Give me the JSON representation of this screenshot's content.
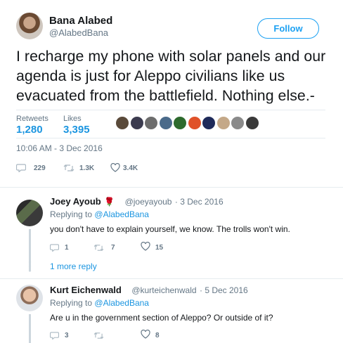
{
  "author": {
    "name": "Bana Alabed",
    "handle": "@AlabedBana",
    "follow_label": "Follow"
  },
  "tweet": {
    "text": "I recharge my phone with solar panels and our agenda is just for Aleppo civilians like us evacuated from the battlefield. Nothing else.-",
    "retweets_label": "Retweets",
    "retweets": "1,280",
    "likes_label": "Likes",
    "likes": "3,395",
    "timestamp": "10:06 AM - 3 Dec 2016",
    "reply_count": "229",
    "retweet_count": "1.3K",
    "like_count": "3.4K"
  },
  "likers": [
    {
      "color": "#5a4a3a"
    },
    {
      "color": "#3b3b4f"
    },
    {
      "color": "#6d6d6d"
    },
    {
      "color": "#4a6a8a"
    },
    {
      "color": "#2d6a2d"
    },
    {
      "color": "#e0522a"
    },
    {
      "color": "#1e2a5a"
    },
    {
      "color": "#c4a888"
    },
    {
      "color": "#8a8a8a"
    },
    {
      "color": "#3a3a3a"
    }
  ],
  "replies": [
    {
      "name": "Joey Ayoub",
      "emoji": "🌹",
      "handle": "@joeyayoub",
      "date": "· 3 Dec 2016",
      "replying_prefix": "Replying to",
      "replying_to": "@AlabedBana",
      "text": "you don't have to explain yourself, we know. The trolls won't win.",
      "reply_count": "1",
      "retweet_count": "7",
      "like_count": "15"
    },
    {
      "name": "Kurt Eichenwald",
      "handle": "@kurteichenwald",
      "date": "· 5 Dec 2016",
      "replying_prefix": "Replying to",
      "replying_to": "@AlabedBana",
      "text": "Are u in the government section of Aleppo? Or outside of it?",
      "reply_count": "3",
      "retweet_count": "",
      "like_count": "8"
    }
  ],
  "more_replies_label": "1 more reply"
}
